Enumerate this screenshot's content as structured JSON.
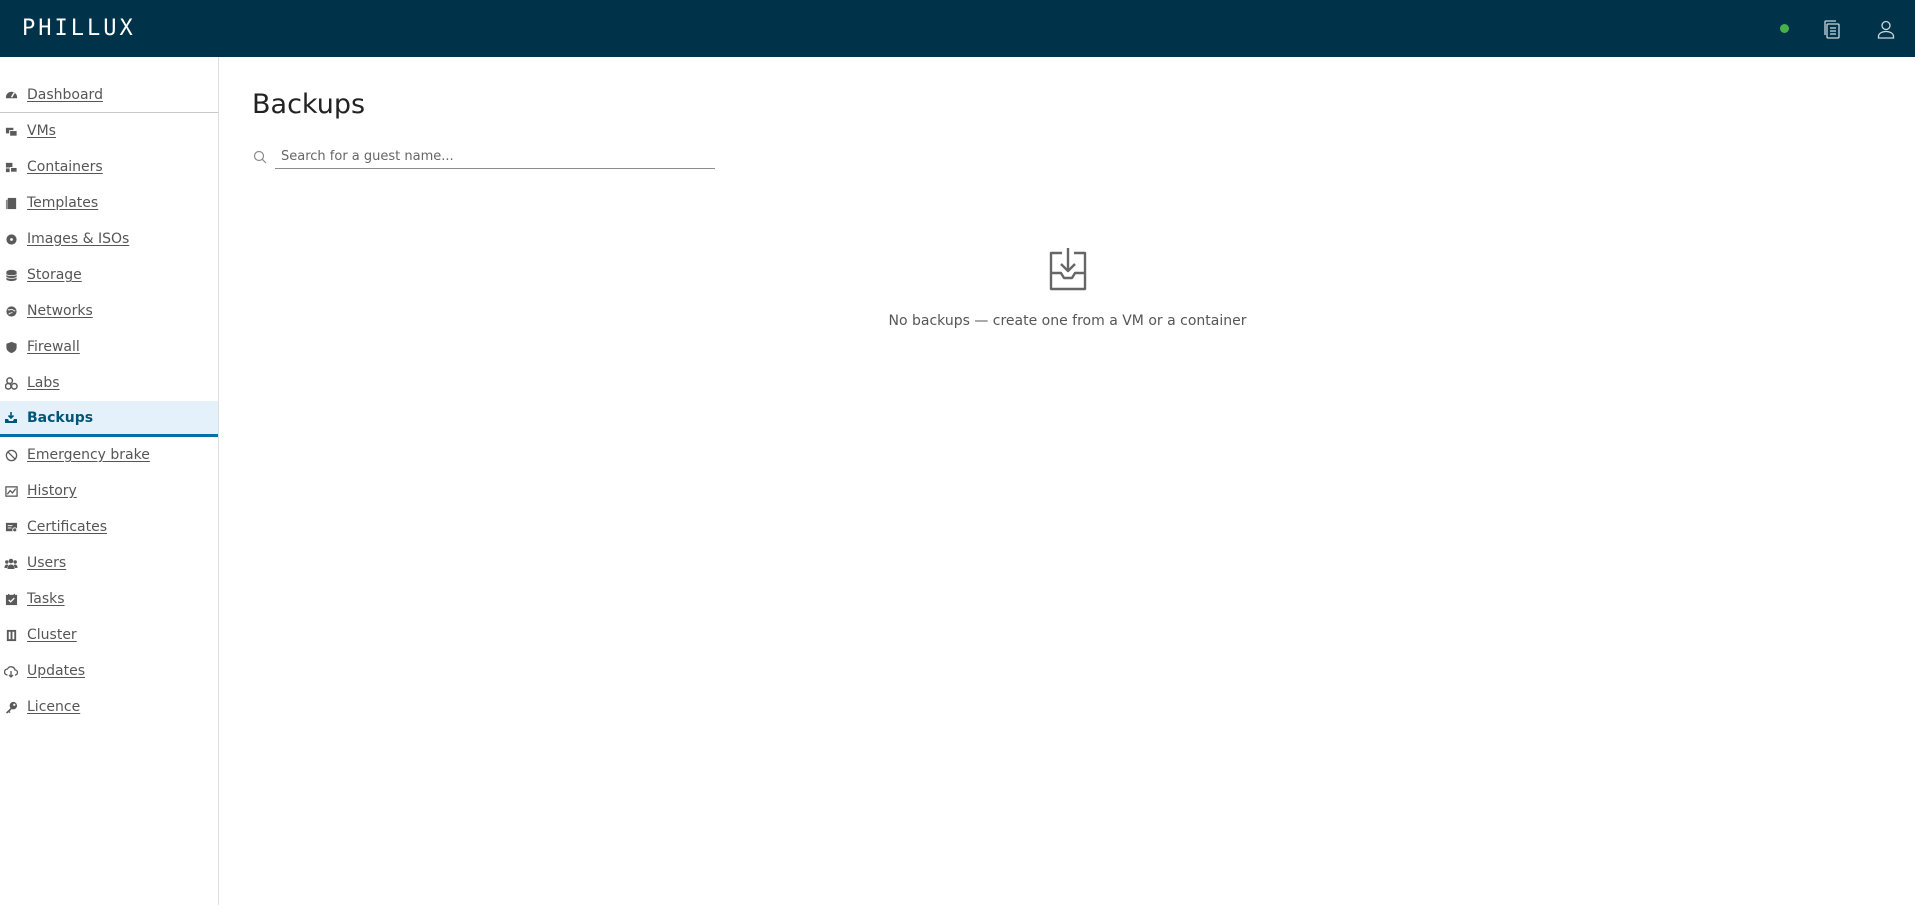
{
  "header": {
    "brand": "PHILLUX",
    "status_color": "#48b048",
    "icons": [
      "status-dot",
      "tasks-list-icon",
      "user-icon"
    ]
  },
  "sidebar": {
    "items": [
      {
        "label": "Dashboard",
        "icon": "dashboard-icon"
      },
      {
        "label": "VMs",
        "icon": "vms-icon"
      },
      {
        "label": "Containers",
        "icon": "containers-icon"
      },
      {
        "label": "Templates",
        "icon": "templates-icon"
      },
      {
        "label": "Images & ISOs",
        "icon": "images-isos-icon"
      },
      {
        "label": "Storage",
        "icon": "storage-icon"
      },
      {
        "label": "Networks",
        "icon": "networks-icon"
      },
      {
        "label": "Firewall",
        "icon": "firewall-icon"
      },
      {
        "label": "Labs",
        "icon": "labs-icon"
      },
      {
        "label": "Backups",
        "icon": "backups-icon",
        "active": true
      },
      {
        "label": "Emergency brake",
        "icon": "emergency-brake-icon"
      },
      {
        "label": "History",
        "icon": "history-icon"
      },
      {
        "label": "Certificates",
        "icon": "certificates-icon"
      },
      {
        "label": "Users",
        "icon": "users-icon"
      },
      {
        "label": "Tasks",
        "icon": "tasks-icon"
      },
      {
        "label": "Cluster",
        "icon": "cluster-icon"
      },
      {
        "label": "Updates",
        "icon": "updates-icon"
      },
      {
        "label": "Licence",
        "icon": "licence-icon"
      }
    ]
  },
  "main": {
    "title": "Backups",
    "search": {
      "placeholder": "Search for a guest name...",
      "value": ""
    },
    "empty_state": {
      "icon": "download-tray-icon",
      "message": "No backups — create one from a VM or a container"
    }
  },
  "colors": {
    "header_bg": "#003349",
    "active_bg": "#e5f1fa",
    "active_accent": "#0072a3"
  }
}
